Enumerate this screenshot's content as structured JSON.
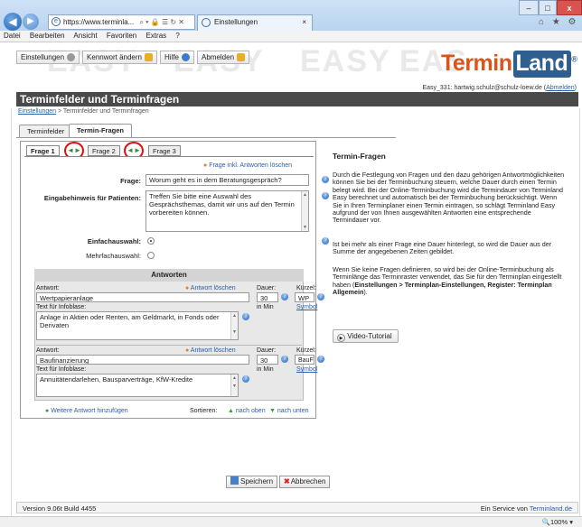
{
  "browser": {
    "url": "https://www.terminla...",
    "url_icons": "⌕ ▾ 🔒 ☰ ↻ ✕",
    "tab_title": "Einstellungen",
    "tab_close": "×",
    "window_controls": {
      "minimize": "–",
      "maximize": "□",
      "close": "x"
    },
    "right_icons": "⌂ ★ ⚙",
    "menu": [
      "Datei",
      "Bearbeiten",
      "Ansicht",
      "Favoriten",
      "Extras",
      "?"
    ]
  },
  "toolbar": {
    "einstellungen": "Einstellungen",
    "kennwort": "Kennwort ändern",
    "hilfe": "Hilfe",
    "abmelden": "Abmelden"
  },
  "watermark": [
    "EASY",
    "EASY",
    "EASY",
    "EAS"
  ],
  "logo": {
    "part1": "Termin",
    "part2": "Land",
    "reg": "®"
  },
  "account": {
    "text": "Easy_331: hartwig.schulz@schulz-loew.de (",
    "link": "Abmelden",
    "close": ")"
  },
  "page_title": "Terminfelder und Terminfragen",
  "breadcrumb": {
    "link": "Einstellungen",
    "rest": " > Terminfelder und Terminfragen"
  },
  "tabs": [
    "Terminfelder",
    "Termin-Fragen"
  ],
  "question_tabs": [
    "Frage 1",
    "Frage 2",
    "Frage 3"
  ],
  "arrows": "◄►",
  "delete_question": "Frage inkl. Antworten löschen",
  "form": {
    "frage_label": "Frage:",
    "frage_value": "Worum geht es in dem Beratungsgespräch?",
    "hint_label": "Eingabehinweis für Patienten:",
    "hint_value": "Treffen Sie bitte eine Auswahl des Gesprächsthemas, damit wir uns auf den Termin vorbereiten können.",
    "single_label": "Einfachauswahl:",
    "multi_label": "Mehrfachauswahl:"
  },
  "answers": {
    "header": "Antworten",
    "antwort_label": "Antwort:",
    "delete_label": "Antwort löschen",
    "dauer_label": "Dauer:",
    "kuerzel_label": "Kürzel:",
    "infotext_label": "Text für Infoblase:",
    "in_min": "in Min",
    "symbol": "Symbol",
    "items": [
      {
        "name": "Wertpapieranlage",
        "dauer": "30",
        "kuerzel": "WP",
        "info": "Anlage in Aktien oder Renten, am Geldmarkt, in Fonds oder Derivaten"
      },
      {
        "name": "Baufinanzierung",
        "dauer": "30",
        "kuerzel": "BauFi",
        "info": "Annuitätendarlehen, Bausparverträge, KfW-Kredite"
      }
    ],
    "add": "Weitere Antwort hinzufügen",
    "sort_label": "Sortieren:",
    "up": "nach oben",
    "down": "nach unten"
  },
  "help": {
    "title": "Termin-Fragen",
    "p1": "Durch die Festlegung von Fragen und den dazu gehörigen Antwortmöglichkeiten können Sie bei der Terminbuchung steuern, welche Dauer durch einen Termin belegt wird. Bei der Online-Terminbuchung wird die Termindauer von Terminland Easy berechnet und automatisch bei der Terminbuchung berücksichtigt. Wenn Sie in Ihren Terminplaner einen Termin eintragen, so schlägt Terminland Easy aufgrund der von Ihnen ausgewählten Antworten eine entsprechende Termindauer vor.",
    "p2": "Ist bei mehr als einer Frage eine Dauer hinterlegt, so wird die Dauer aus der Summe der angegebenen Zeiten gebildet.",
    "p3a": "Wenn Sie keine Fragen definieren, so wird bei der Online-Terminbuchung als Terminlänge das Terminraster verwendet, das Sie für den Terminplan eingestellt haben (",
    "p3b": "Einstellungen > Terminplan-Einstellungen, Register: Terminplan Allgemein",
    "p3c": ").",
    "video": "Video-Tutorial"
  },
  "buttons": {
    "save": "Speichern",
    "cancel": "Abbrechen"
  },
  "footer": {
    "version": "Version 9.06t Build 4455",
    "service_text": "Ein Service von ",
    "service_link": "Terminland.de"
  },
  "status": {
    "zoom": "100%"
  }
}
